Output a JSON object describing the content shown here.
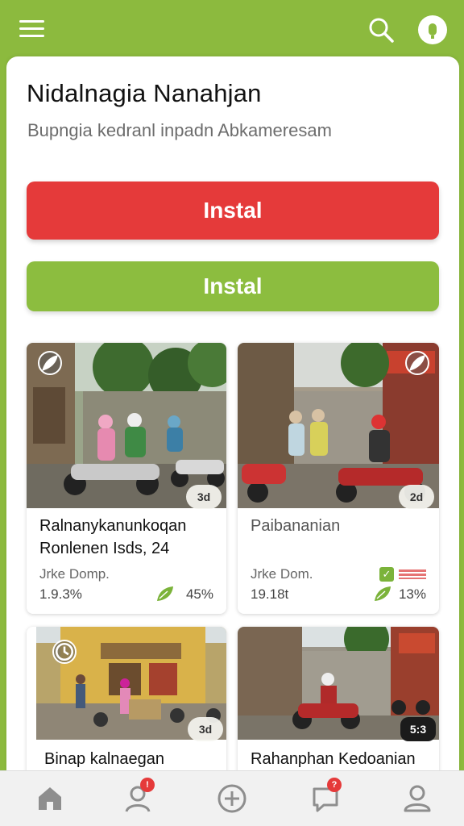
{
  "header": {
    "menu_icon": "hamburger-menu-icon",
    "search_icon": "search-icon",
    "info_icon": "info-icon"
  },
  "main": {
    "title": "Nidalnagia Nanahjan",
    "subtitle": "Bupngia kedranl inpadn Abkameresam",
    "buttons": [
      {
        "label": "Instal",
        "color": "#e53a3a"
      },
      {
        "label": "Instal",
        "color": "#8cbd3f"
      }
    ]
  },
  "cards": [
    {
      "title_line1": "Ralnanykanunkoqan",
      "title_line2": "Ronlenen Isds, 24",
      "meta": "Jrke Domp.",
      "count": "1.9.3%",
      "percent": "45%",
      "badge": "3d",
      "corner_icon": "leaf-icon"
    },
    {
      "title_line1": "Paibananian",
      "meta": "Jrke Dom.",
      "count": "19.18t",
      "percent": "13%",
      "badge": "2d",
      "corner_icon": "leaf-icon"
    },
    {
      "title_line1": "Binap kalnaegan",
      "badge": "3d",
      "corner_icon": "clock-icon"
    },
    {
      "title_line1": "Rahanphan Kedoanian",
      "badge": "5:3",
      "corner_icon": "none"
    }
  ],
  "bottom_nav": [
    {
      "icon": "home-icon"
    },
    {
      "icon": "user-icon",
      "badge": "!"
    },
    {
      "icon": "add-icon"
    },
    {
      "icon": "chat-icon",
      "badge": "?"
    },
    {
      "icon": "profile-icon"
    }
  ],
  "colors": {
    "brand_green": "#8cba3e",
    "accent_red": "#e53a3a"
  }
}
